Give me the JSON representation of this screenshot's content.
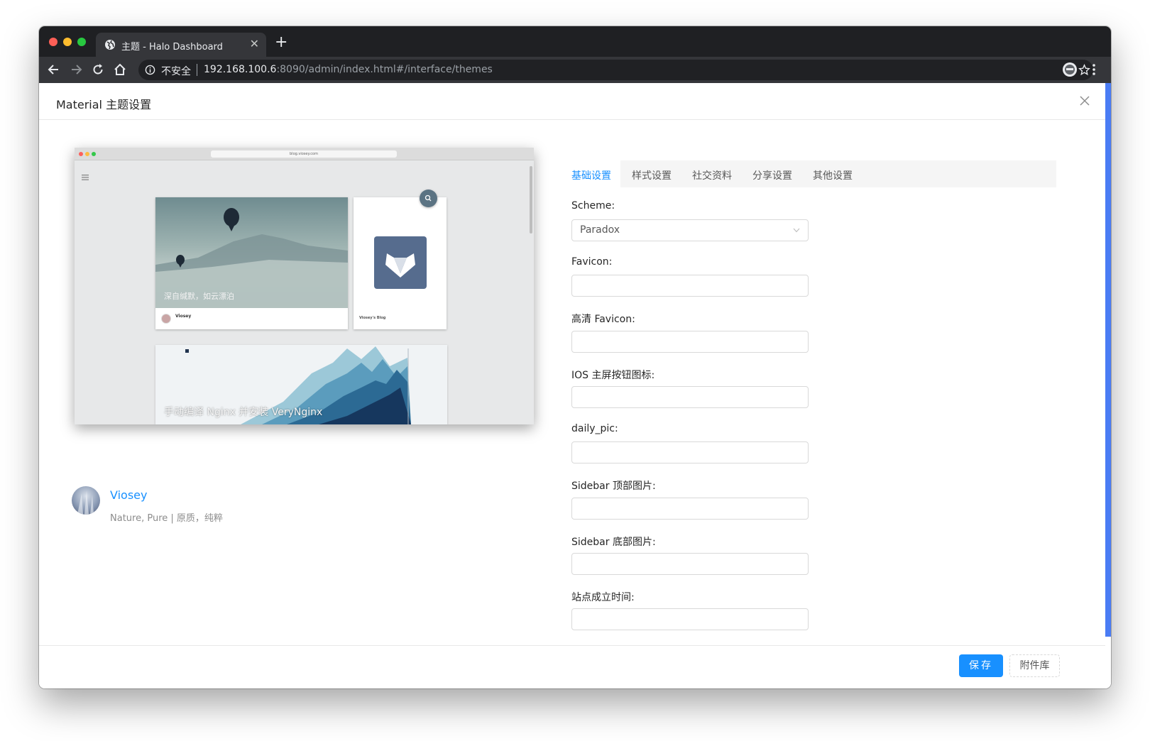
{
  "browser": {
    "tab_title": "主题 - Halo Dashboard",
    "security_label": "不安全",
    "url_host": "192.168.100.6",
    "url_path": ":8090/admin/index.html#/interface/themes"
  },
  "modal": {
    "title": "Material 主题设置"
  },
  "preview": {
    "url": "blog.viosey.com",
    "card1_caption": "深自缄默，如云漂泊",
    "card1_author": "Viosey",
    "card2_footer": "Viosey's Blog",
    "card3_caption": "手动编译 Nginx 并安装 VeryNginx",
    "colors": {
      "logo_bg": "#566c8e",
      "search_bg": "#5b7383"
    }
  },
  "theme": {
    "author_name": "Viosey",
    "description": "Nature, Pure | 原质，纯粹"
  },
  "tabs": [
    {
      "label": "基础设置",
      "active": true
    },
    {
      "label": "样式设置",
      "active": false
    },
    {
      "label": "社交资料",
      "active": false
    },
    {
      "label": "分享设置",
      "active": false
    },
    {
      "label": "其他设置",
      "active": false
    }
  ],
  "form": {
    "scheme_label": "Scheme:",
    "scheme_value": "Paradox",
    "favicon_label": "Favicon:",
    "hd_favicon_label": "高清 Favicon:",
    "ios_icon_label": "IOS 主屏按钮图标:",
    "daily_pic_label": "daily_pic:",
    "sidebar_top_label": "Sidebar 顶部图片:",
    "sidebar_bottom_label": "Sidebar 底部图片:",
    "site_founded_label": "站点成立时间:"
  },
  "footer": {
    "save_label": "保存",
    "attachments_label": "附件库"
  },
  "colors": {
    "primary": "#1890ff",
    "chrome_dark": "#1f2023",
    "chrome_toolbar": "#35363a"
  }
}
